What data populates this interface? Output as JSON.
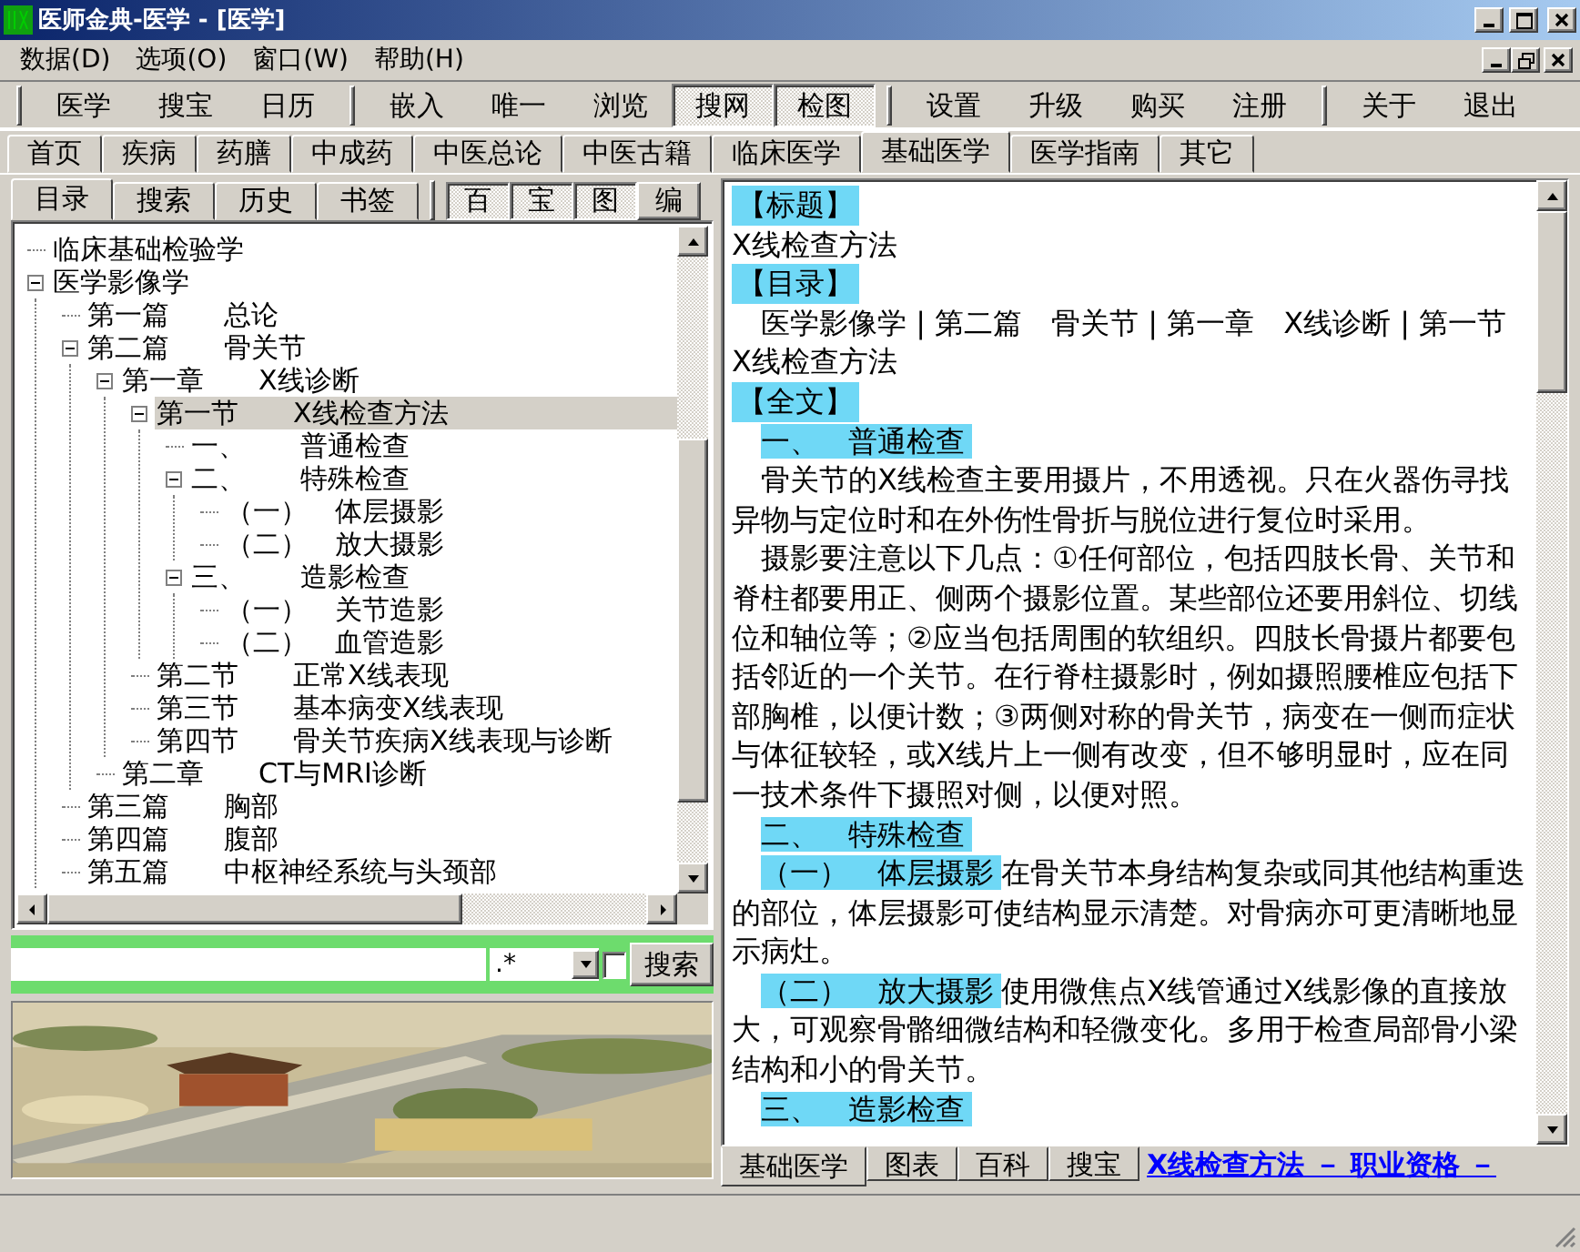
{
  "window": {
    "title": "医师金典-医学 - [医学]"
  },
  "menu": [
    "数据(D)",
    "选项(O)",
    "窗口(W)",
    "帮助(H)"
  ],
  "toolbar": [
    [
      {
        "label": "医学",
        "pressed": false
      },
      {
        "label": "搜宝",
        "pressed": false
      },
      {
        "label": "日历",
        "pressed": false
      }
    ],
    [
      {
        "label": "嵌入",
        "pressed": false
      },
      {
        "label": "唯一",
        "pressed": false
      },
      {
        "label": "浏览",
        "pressed": false
      },
      {
        "label": "搜网",
        "pressed": true
      },
      {
        "label": "检图",
        "pressed": true
      }
    ],
    [
      {
        "label": "设置",
        "pressed": false
      },
      {
        "label": "升级",
        "pressed": false
      },
      {
        "label": "购买",
        "pressed": false
      },
      {
        "label": "注册",
        "pressed": false
      }
    ],
    [
      {
        "label": "关于",
        "pressed": false
      },
      {
        "label": "退出",
        "pressed": false
      }
    ]
  ],
  "tabs": [
    {
      "label": "首页",
      "selected": false
    },
    {
      "label": "疾病",
      "selected": false
    },
    {
      "label": "药膳",
      "selected": false
    },
    {
      "label": "中成药",
      "selected": false
    },
    {
      "label": "中医总论",
      "selected": false
    },
    {
      "label": "中医古籍",
      "selected": false
    },
    {
      "label": "临床医学",
      "selected": false
    },
    {
      "label": "基础医学",
      "selected": true
    },
    {
      "label": "医学指南",
      "selected": false
    },
    {
      "label": "其它",
      "selected": false
    }
  ],
  "sidebar": {
    "tabs": [
      {
        "label": "目录",
        "selected": true
      },
      {
        "label": "搜索",
        "selected": false
      },
      {
        "label": "历史",
        "selected": false
      },
      {
        "label": "书签",
        "selected": false
      }
    ],
    "toggles": [
      {
        "label": "百",
        "pressed": true
      },
      {
        "label": "宝",
        "pressed": true
      },
      {
        "label": "图",
        "pressed": true
      },
      {
        "label": "编",
        "pressed": false
      }
    ],
    "tree": [
      {
        "label": "临床基础检验学",
        "selected": false
      },
      {
        "label": "医学影像学",
        "selected": false,
        "expanded": true,
        "children": [
          {
            "label": "第一篇　　总论",
            "selected": false
          },
          {
            "label": "第二篇　　骨关节",
            "selected": false,
            "expanded": true,
            "children": [
              {
                "label": "第一章　　X线诊断",
                "selected": false,
                "expanded": true,
                "children": [
                  {
                    "label": "第一节　　X线检查方法",
                    "selected": true,
                    "expanded": true,
                    "children": [
                      {
                        "label": "一、　　普通检查",
                        "selected": false
                      },
                      {
                        "label": "二、　　特殊检查",
                        "selected": false,
                        "expanded": true,
                        "children": [
                          {
                            "label": "（一）　体层摄影",
                            "selected": false
                          },
                          {
                            "label": "（二）　放大摄影",
                            "selected": false
                          }
                        ]
                      },
                      {
                        "label": "三、　　造影检查",
                        "selected": false,
                        "expanded": true,
                        "children": [
                          {
                            "label": "（一）　关节造影",
                            "selected": false
                          },
                          {
                            "label": "（二）　血管造影",
                            "selected": false
                          }
                        ]
                      }
                    ]
                  },
                  {
                    "label": "第二节　　正常X线表现",
                    "selected": false
                  },
                  {
                    "label": "第三节　　基本病变X线表现",
                    "selected": false
                  },
                  {
                    "label": "第四节　　骨关节疾病X线表现与诊断",
                    "selected": false
                  }
                ]
              },
              {
                "label": "第二章　　CT与MRI诊断",
                "selected": false
              }
            ]
          },
          {
            "label": "第三篇　　胸部",
            "selected": false
          },
          {
            "label": "第四篇　　腹部",
            "selected": false
          },
          {
            "label": "第五篇　　中枢神经系统与头颈部",
            "selected": false
          }
        ]
      }
    ],
    "search": {
      "pattern": ".*",
      "regex_checked": false,
      "button": "搜索"
    }
  },
  "content": [
    {
      "kind": "label",
      "text": "【标题】"
    },
    {
      "kind": "plain",
      "text": "X线检查方法"
    },
    {
      "kind": "label",
      "text": "【目录】"
    },
    {
      "kind": "para",
      "text": "医学影像学 | 第二篇　骨关节 | 第一章　X线诊断 | 第一节　X线检查方法"
    },
    {
      "kind": "label",
      "text": "【全文】"
    },
    {
      "kind": "section",
      "text": "一、　普通检查"
    },
    {
      "kind": "para",
      "text": "骨关节的X线检查主要用摄片，不用透视。只在火器伤寻找异物与定位时和在外伤性骨折与脱位进行复位时采用。"
    },
    {
      "kind": "para",
      "text": "摄影要注意以下几点：①任何部位，包括四肢长骨、关节和脊柱都要用正、侧两个摄影位置。某些部位还要用斜位、切线位和轴位等；②应当包括周围的软组织。四肢长骨摄片都要包括邻近的一个关节。在行脊柱摄影时，例如摄照腰椎应包括下部胸椎，以便计数；③两侧对称的骨关节，病变在一侧而症状与体征较轻，或X线片上一侧有改变，但不够明显时，应在同一技术条件下摄照对侧，以便对照。"
    },
    {
      "kind": "section",
      "text": "二、　特殊检查"
    },
    {
      "kind": "sub",
      "label": "（一）　体层摄影",
      "text": "在骨关节本身结构复杂或同其他结构重迭的部位，体层摄影可使结构显示清楚。对骨病亦可更清晰地显示病灶。"
    },
    {
      "kind": "sub",
      "label": "（二）　放大摄影",
      "text": "使用微焦点X线管通过X线影像的直接放大，可观察骨骼细微结构和轻微变化。多用于检查局部骨小梁结构和小的骨关节。"
    },
    {
      "kind": "section",
      "text": "三、　造影检查"
    }
  ],
  "content_tabs": [
    {
      "label": "基础医学",
      "selected": true
    },
    {
      "label": "图表",
      "selected": false
    },
    {
      "label": "百科",
      "selected": false
    },
    {
      "label": "搜宝",
      "selected": false
    }
  ],
  "content_link": "X线检查方法 － 职业资格 －"
}
